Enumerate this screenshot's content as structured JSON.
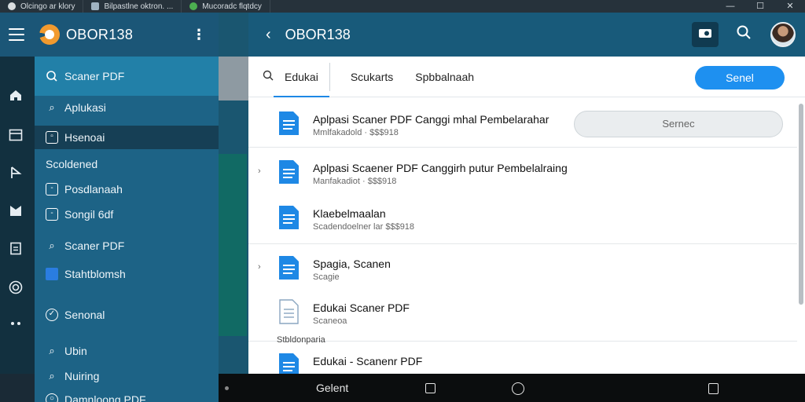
{
  "browser": {
    "tabs": [
      {
        "label": "Olcingo ar klory",
        "icon": "globe-icon"
      },
      {
        "label": "Bilpastlne oktron. ...",
        "icon": "page-icon"
      },
      {
        "label": "Mucoradc flqtdcy",
        "icon": "green-circle-icon"
      }
    ],
    "window_controls": {
      "minimize": "—",
      "maximize": "☐",
      "close": "✕"
    }
  },
  "rail": {
    "icons": [
      "home-icon",
      "inbox-icon",
      "share-icon",
      "bookmark-icon",
      "clipboard-icon",
      "target-icon",
      "more-icon"
    ]
  },
  "app": {
    "title": "OBOR138",
    "menu_icon": "hamburger-icon",
    "overflow_icon": "⋮"
  },
  "drawer": {
    "search_label": "Scaner PDF",
    "items": [
      {
        "label": "Aplukasi",
        "icon": "search-icon",
        "glyph": "⌕",
        "style": "plain",
        "selected": false
      },
      {
        "label": "Hsenoai",
        "icon": "square-icon",
        "glyph": "▫",
        "style": "box",
        "selected": true
      },
      {
        "label": "Scoldened",
        "icon": "",
        "glyph": "",
        "style": "header",
        "selected": false
      },
      {
        "label": "Posdlanaah",
        "icon": "square-icon",
        "glyph": "-",
        "style": "box",
        "selected": false
      },
      {
        "label": "Songil 6df",
        "icon": "square-icon",
        "glyph": "-",
        "style": "box",
        "selected": false
      },
      {
        "label": "Scaner PDF",
        "icon": "search-icon",
        "glyph": "⌕",
        "style": "plain",
        "selected": false
      },
      {
        "label": "Stahtblomsh",
        "icon": "blue-square-icon",
        "glyph": "",
        "style": "blue",
        "selected": false
      },
      {
        "label": "Senonal",
        "icon": "check-circle-icon",
        "glyph": "✓",
        "style": "circ",
        "selected": false
      },
      {
        "label": "Ubin",
        "icon": "search-icon",
        "glyph": "⌕",
        "style": "plain",
        "selected": false
      },
      {
        "label": "Nuiring",
        "icon": "search-icon",
        "glyph": "⌕",
        "style": "plain",
        "selected": false
      },
      {
        "label": "Damnloong PDF",
        "icon": "circle-icon",
        "glyph": "○",
        "style": "circ",
        "selected": false
      }
    ]
  },
  "main": {
    "back_icon": "‹",
    "title": "OBOR138",
    "camera_icon": "camera-icon",
    "search_icon": "search-icon",
    "tabs": [
      {
        "label": "Edukai",
        "active": true
      },
      {
        "label": "Scukarts",
        "active": false
      },
      {
        "label": "Spbbalnaah",
        "active": false
      }
    ],
    "send_button": "Senel",
    "list": [
      {
        "title": "Aplpasi Scaner PDF Canggi mhal Pembelarahar",
        "subtitle": "Mmlfakadold · $$$918",
        "chevron": false,
        "pill": "Sernec"
      },
      {
        "title": "Aplpasi Scaener PDF Canggirh putur Pembelalraing",
        "subtitle": "Manfakadiot · $$$918",
        "chevron": true,
        "pill": ""
      },
      {
        "title": "Klaebelmaalan",
        "subtitle": "Scadendoelner lar $$$918",
        "chevron": false,
        "pill": ""
      },
      {
        "title": "Spagia, Scanen",
        "subtitle": "Scagie",
        "chevron": true,
        "pill": ""
      },
      {
        "title": "Edukai  Scaner PDF",
        "subtitle": "Scaneoa",
        "chevron": false,
        "pill": ""
      },
      {
        "title": "Edukai - Scanenr PDF",
        "subtitle": "",
        "chevron": false,
        "pill": ""
      }
    ],
    "section_label": "Stbldonparia"
  },
  "navbar": {
    "label": "Gelent"
  },
  "colors": {
    "accent": "#1e90f0",
    "header": "#185a7a",
    "drawer": "#1d6386"
  }
}
